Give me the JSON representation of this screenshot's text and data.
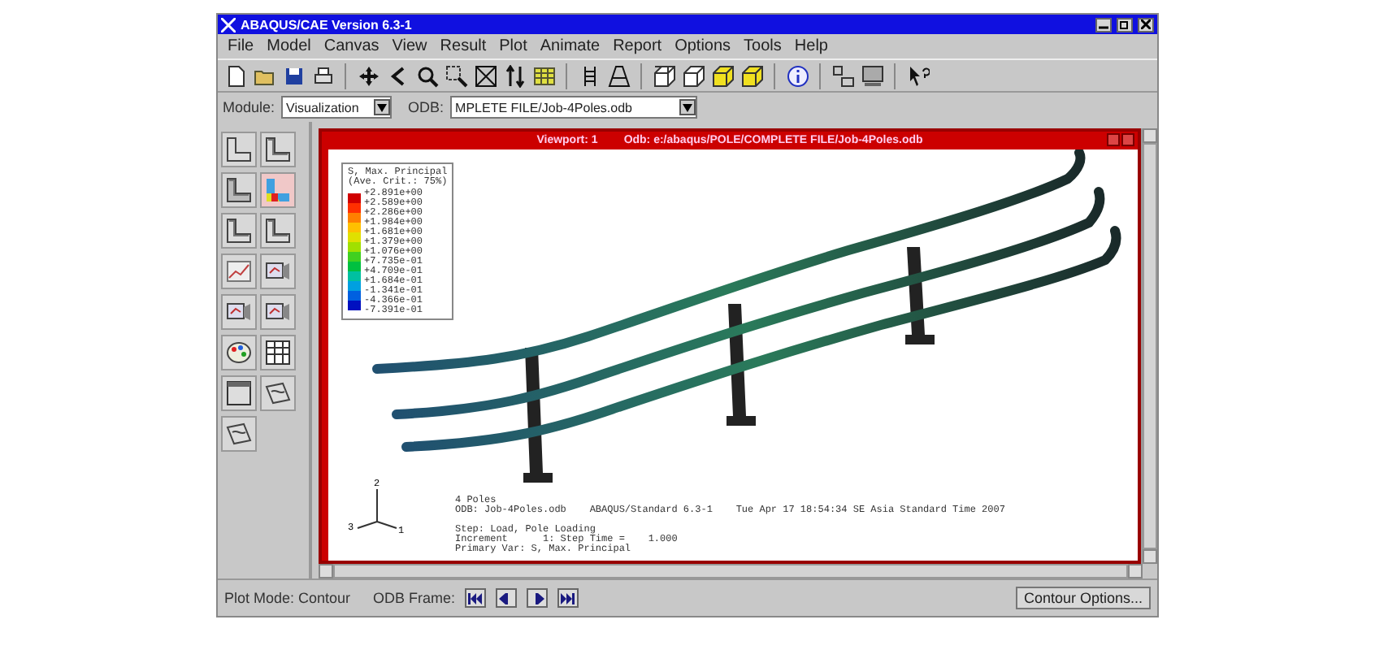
{
  "window": {
    "title": "ABAQUS/CAE Version 6.3-1"
  },
  "menu": [
    "File",
    "Model",
    "Canvas",
    "View",
    "Result",
    "Plot",
    "Animate",
    "Report",
    "Options",
    "Tools",
    "Help"
  ],
  "toolbar": [
    {
      "kind": "new"
    },
    {
      "kind": "open"
    },
    {
      "kind": "save"
    },
    {
      "kind": "print"
    },
    {
      "kind": "sep"
    },
    {
      "kind": "pan"
    },
    {
      "kind": "rotate"
    },
    {
      "kind": "zoom"
    },
    {
      "kind": "boxzoom"
    },
    {
      "kind": "fit"
    },
    {
      "kind": "arrows"
    },
    {
      "kind": "table"
    },
    {
      "kind": "sep"
    },
    {
      "kind": "ruler"
    },
    {
      "kind": "perspective"
    },
    {
      "kind": "sep"
    },
    {
      "kind": "wire"
    },
    {
      "kind": "hidden"
    },
    {
      "kind": "filled"
    },
    {
      "kind": "shaded"
    },
    {
      "kind": "sep"
    },
    {
      "kind": "info"
    },
    {
      "kind": "sep"
    },
    {
      "kind": "layout"
    },
    {
      "kind": "monitor"
    },
    {
      "kind": "sep"
    },
    {
      "kind": "help"
    }
  ],
  "module": {
    "label": "Module:",
    "value": "Visualization"
  },
  "odb": {
    "label": "ODB:",
    "value": "MPLETE FILE/Job-4Poles.odb"
  },
  "toolbox": [
    {
      "kind": "undeformed",
      "selected": false
    },
    {
      "kind": "deformed",
      "selected": false
    },
    {
      "kind": "overlay",
      "selected": false
    },
    {
      "kind": "contour",
      "selected": true
    },
    {
      "kind": "symbol",
      "selected": false
    },
    {
      "kind": "material",
      "selected": false
    },
    {
      "kind": "xy",
      "selected": false
    },
    {
      "kind": "animate",
      "selected": false
    },
    {
      "kind": "animate2",
      "selected": false
    },
    {
      "kind": "animate3",
      "selected": false
    },
    {
      "kind": "palette",
      "selected": false
    },
    {
      "kind": "grid",
      "selected": false
    },
    {
      "kind": "window",
      "selected": false
    },
    {
      "kind": "mesh",
      "selected": false
    },
    {
      "kind": "mesh2",
      "selected": false
    }
  ],
  "viewport": {
    "title": "Viewport: 1",
    "odb": "Odb: e:/abaqus/POLE/COMPLETE FILE/Job-4Poles.odb",
    "legend": {
      "title": "S, Max. Principal",
      "subtitle": "(Ave. Crit.: 75%)",
      "values": [
        "+2.891e+00",
        "+2.589e+00",
        "+2.286e+00",
        "+1.984e+00",
        "+1.681e+00",
        "+1.379e+00",
        "+1.076e+00",
        "+7.735e-01",
        "+4.709e-01",
        "+1.684e-01",
        "-1.341e-01",
        "-4.366e-01",
        "-7.391e-01"
      ]
    },
    "triad": [
      "2",
      "3",
      "1"
    ],
    "info": [
      [
        "4 Poles",
        "ODB: Job-4Poles.odb    ABAQUS/Standard 6.3-1    Tue Apr 17 18:54:34 SE Asia Standard Time 2007"
      ],
      [
        "Step: Load, Pole Loading",
        "Increment      1: Step Time =    1.000",
        "Primary Var: S, Max. Principal"
      ]
    ]
  },
  "status": {
    "mode": "Plot Mode: Contour",
    "frame_label": "ODB Frame:",
    "frame_buttons": [
      {
        "kind": "first"
      },
      {
        "kind": "prev"
      },
      {
        "kind": "next"
      },
      {
        "kind": "last"
      }
    ],
    "options_button": "Contour Options..."
  }
}
